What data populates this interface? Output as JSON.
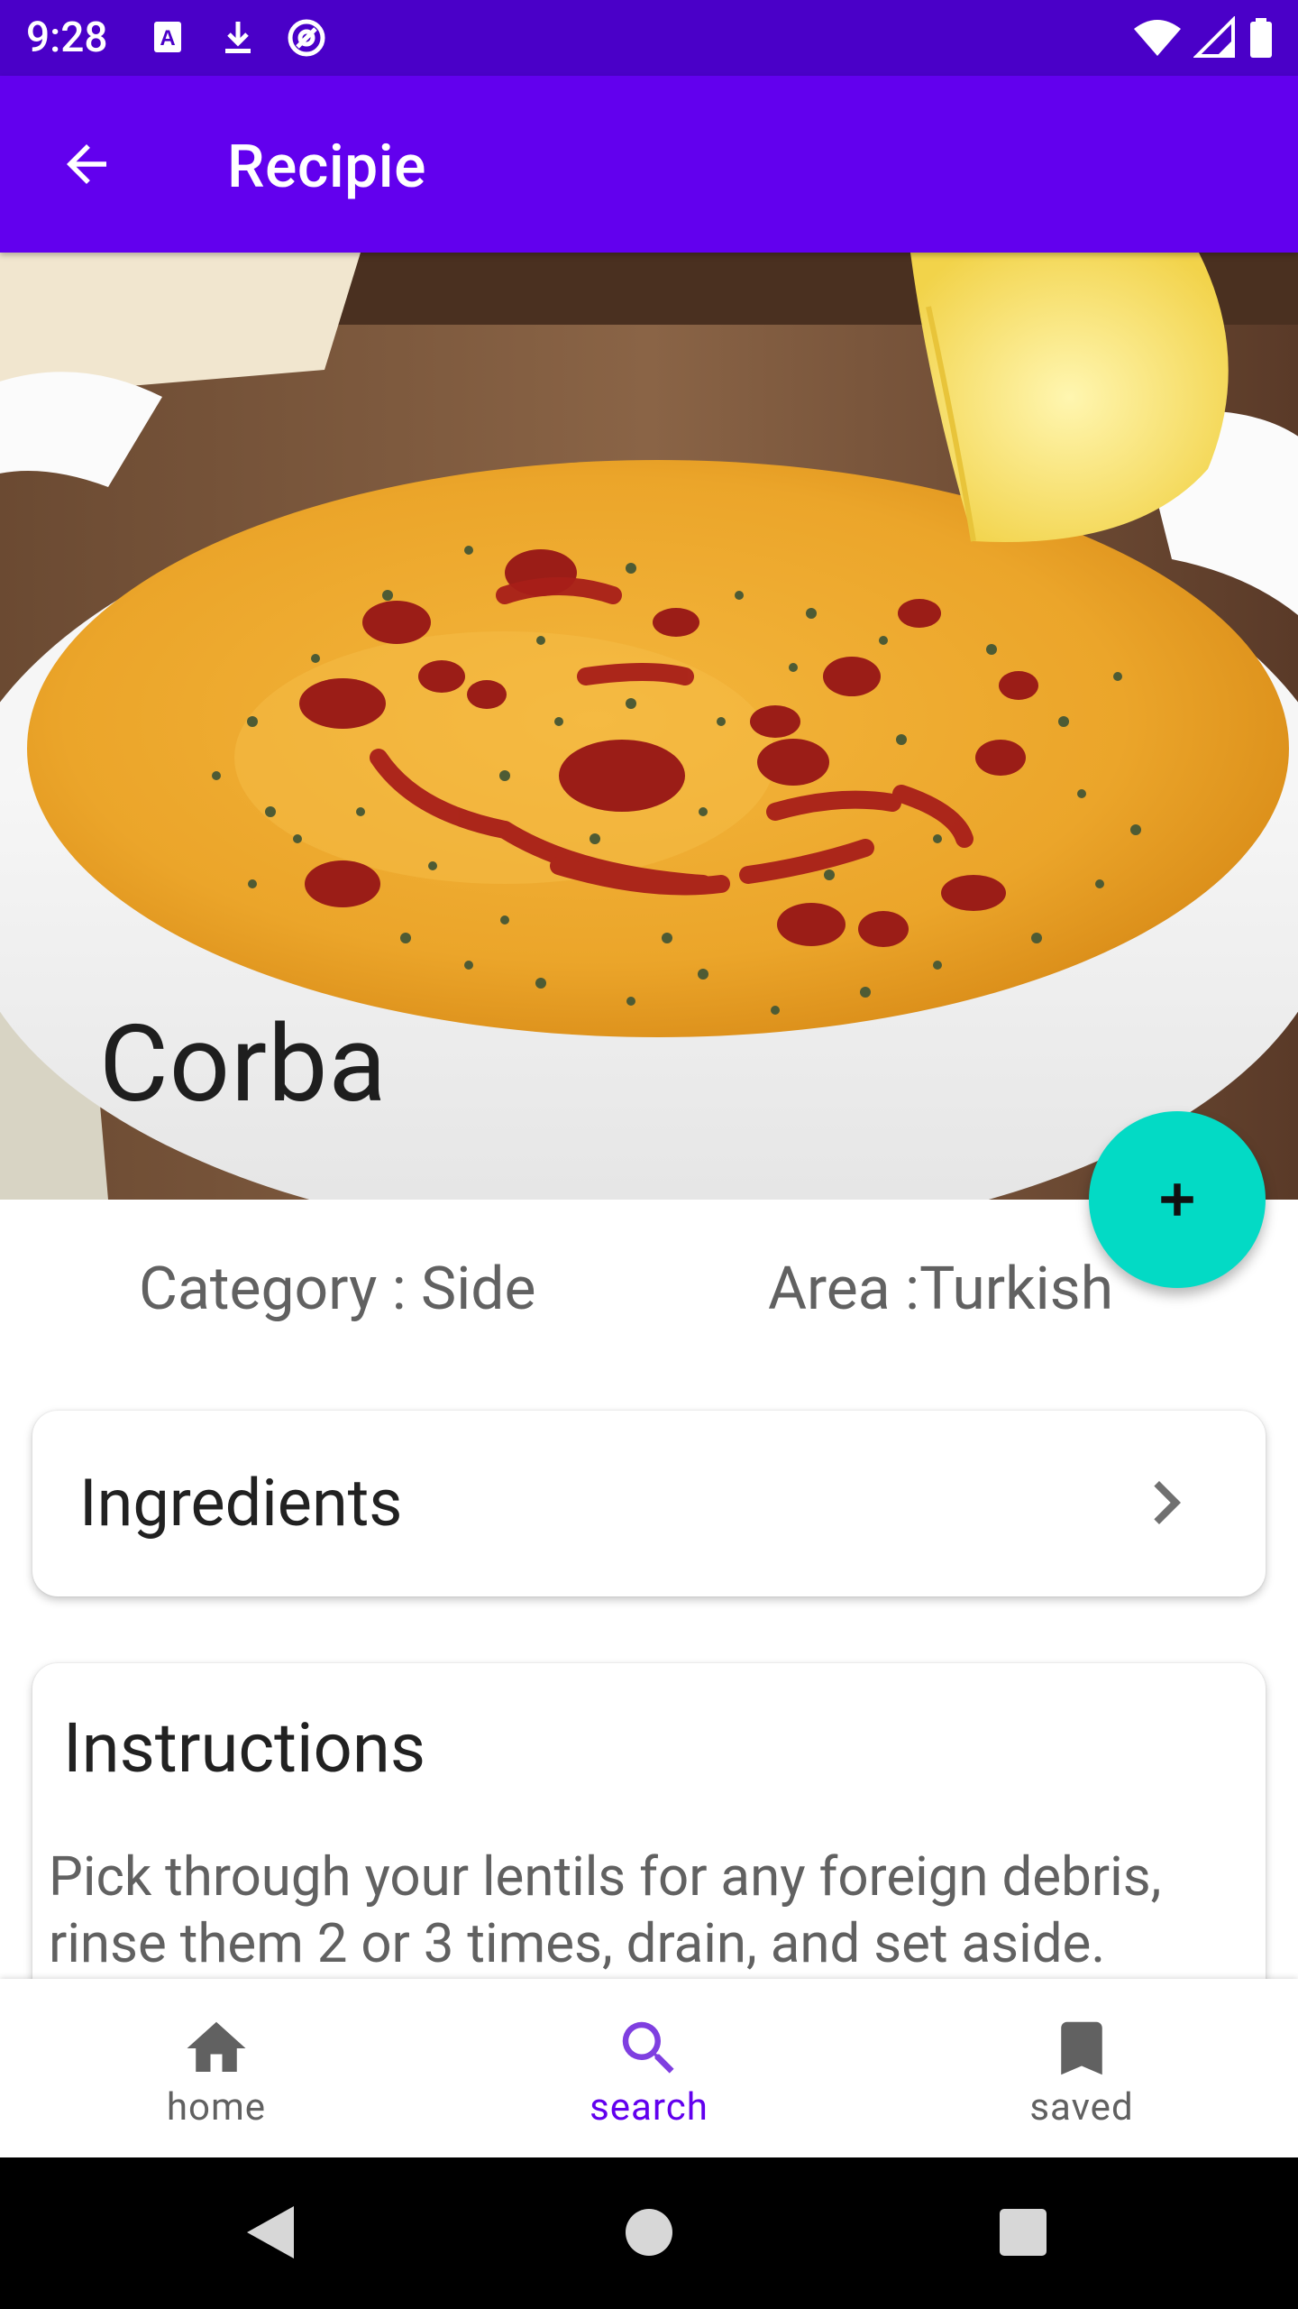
{
  "status_bar": {
    "time": "9:28",
    "left_icons": [
      "keyboard-a-icon",
      "download-icon",
      "at-sign-icon"
    ],
    "right_icons": [
      "wifi-icon",
      "signal-icon",
      "battery-icon"
    ],
    "background": "#4a00c8"
  },
  "app_bar": {
    "title": "Recipie",
    "back_icon": "arrow-back-icon",
    "background": "#6200ee"
  },
  "recipe": {
    "name": "Corba",
    "category": "Category : Side",
    "area": "Area :Turkish"
  },
  "fab": {
    "icon": "plus-icon",
    "color": "#03dac5"
  },
  "ingredients": {
    "title": "Ingredients",
    "icon": "chevron-right-icon"
  },
  "instructions": {
    "title": "Instructions",
    "text": "Pick through your lentils for any foreign debris, rinse them 2 or 3 times, drain, and set aside."
  },
  "bottom_nav": {
    "active_color": "#6200ee",
    "items": [
      {
        "label": "home",
        "icon": "home-icon",
        "active": false
      },
      {
        "label": "search",
        "icon": "search-icon",
        "active": true
      },
      {
        "label": "saved",
        "icon": "bookmark-icon",
        "active": false
      }
    ]
  },
  "system_nav": {
    "buttons": [
      "back-triangle-icon",
      "home-circle-icon",
      "recents-square-icon"
    ]
  }
}
